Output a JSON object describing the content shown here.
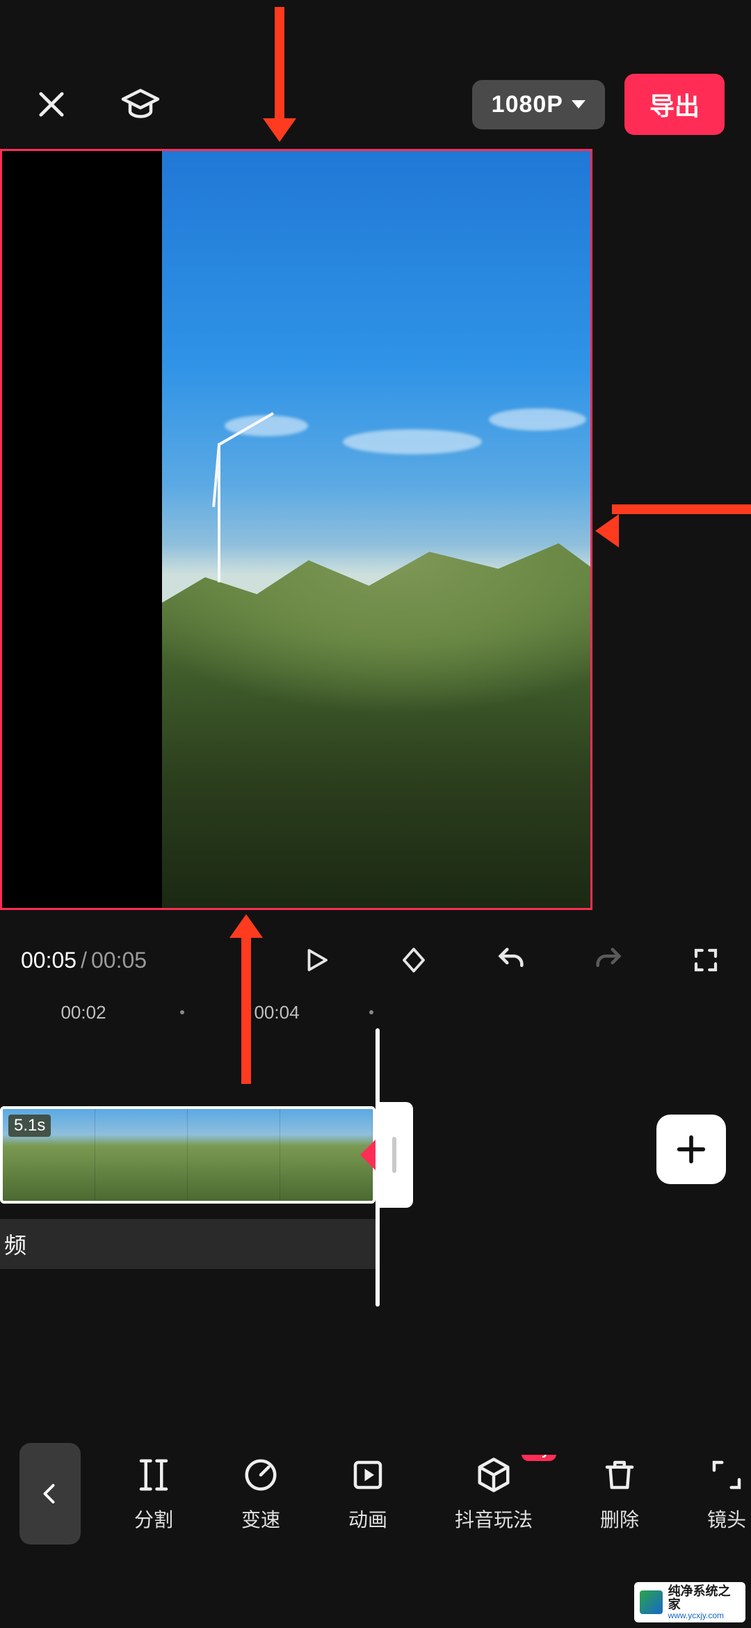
{
  "colors": {
    "accent": "#ff2d55",
    "arrow": "#ff3b1f",
    "bg": "#121212"
  },
  "topbar": {
    "resolution_label": "1080P",
    "export_label": "导出"
  },
  "playbar": {
    "current_time": "00:05",
    "total_time": "00:05"
  },
  "ruler": {
    "ticks": [
      "00:02",
      "00:04"
    ]
  },
  "timeline": {
    "clip_duration_badge": "5.1s",
    "track_label": "频"
  },
  "toolbar": {
    "items": [
      {
        "icon": "split-icon",
        "label": "分割",
        "badge": ""
      },
      {
        "icon": "speed-icon",
        "label": "变速",
        "badge": ""
      },
      {
        "icon": "animation-icon",
        "label": "动画",
        "badge": ""
      },
      {
        "icon": "cube-icon",
        "label": "抖音玩法",
        "badge": "Try"
      },
      {
        "icon": "delete-icon",
        "label": "删除",
        "badge": ""
      },
      {
        "icon": "lens-icon",
        "label": "镜头",
        "badge": ""
      }
    ]
  },
  "watermark": {
    "name": "纯净系统之家",
    "url": "www.ycxjy.com"
  }
}
